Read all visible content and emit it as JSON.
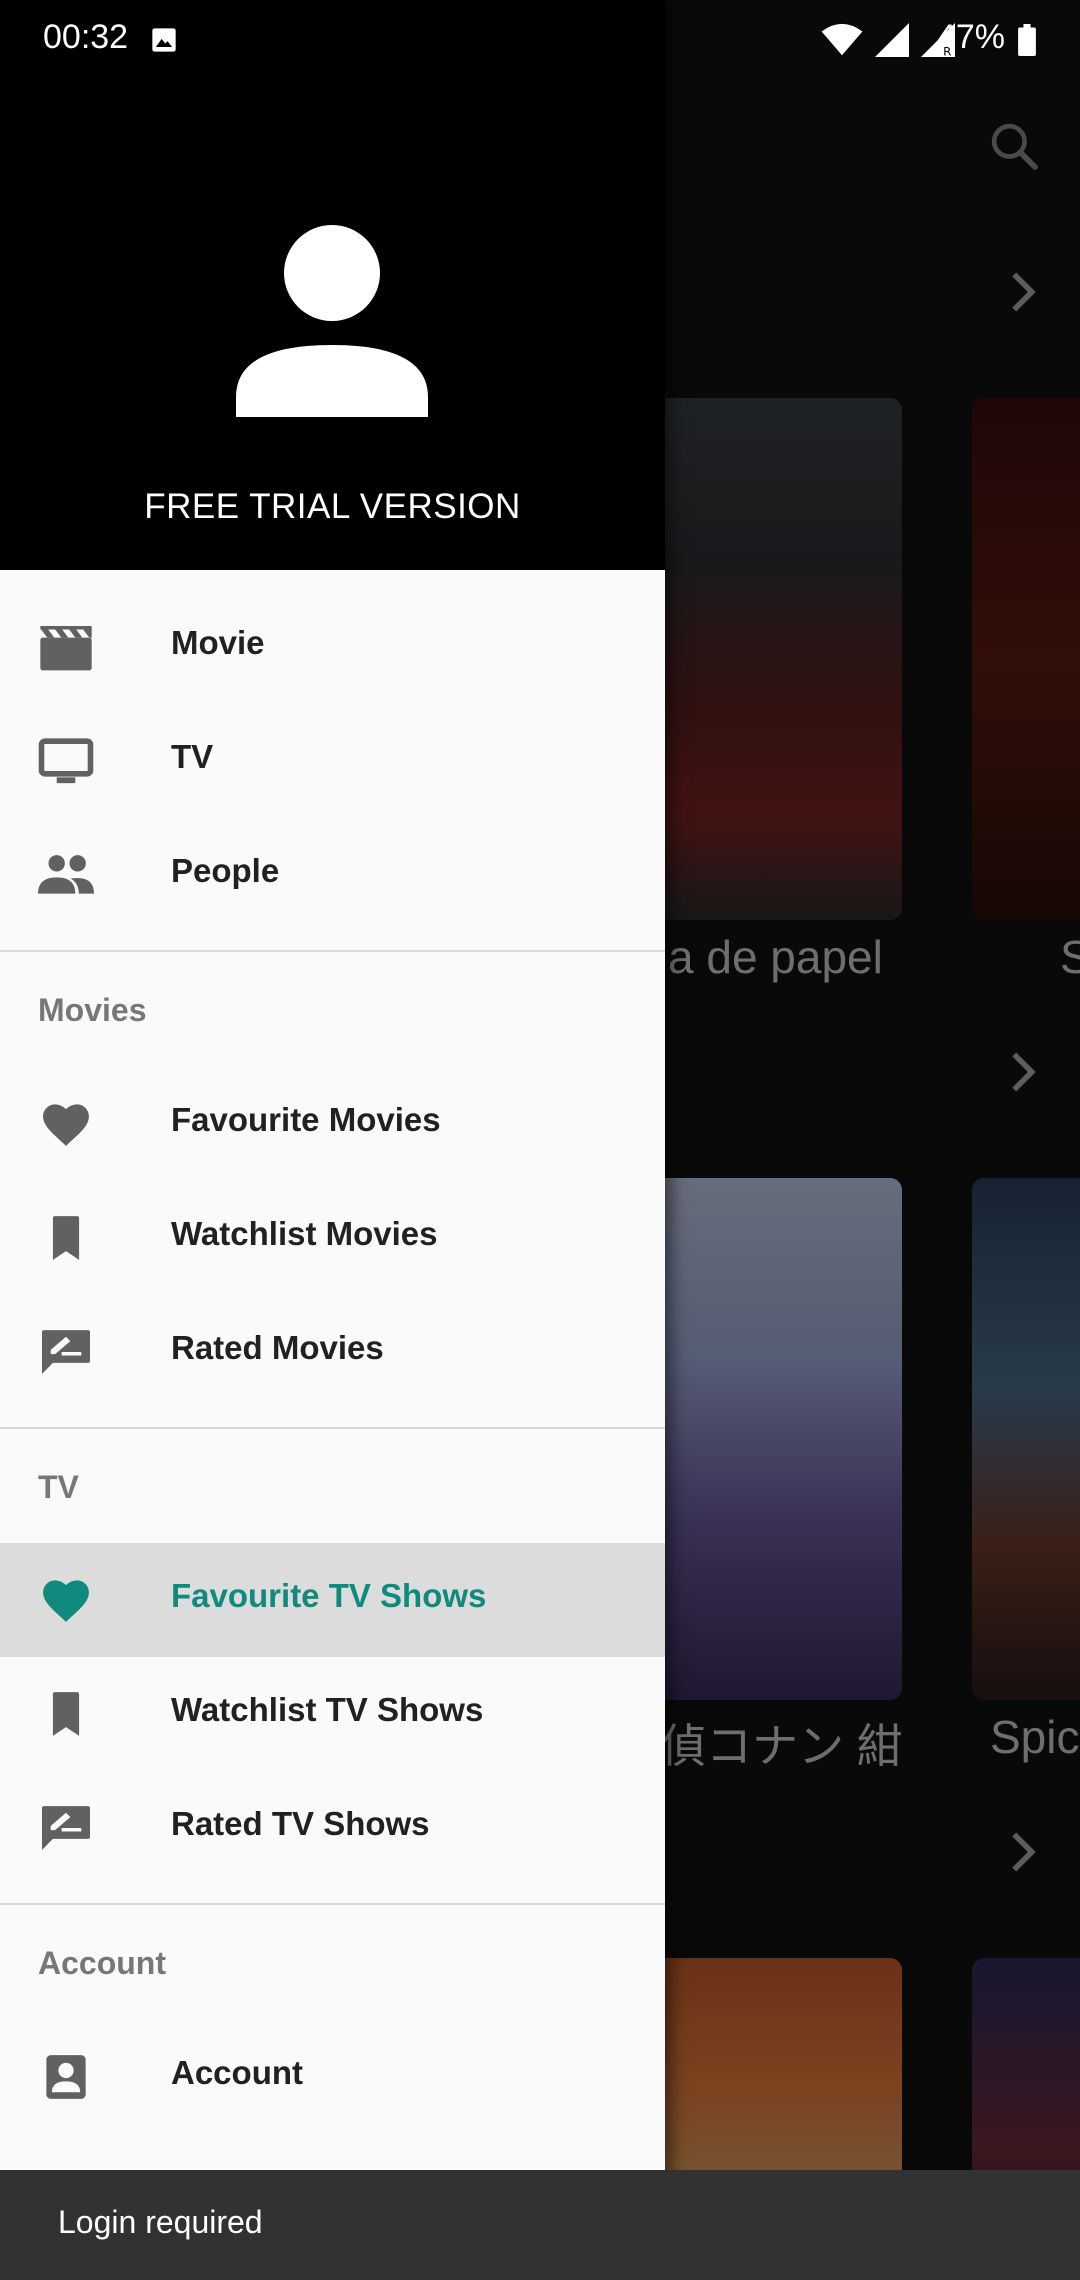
{
  "status_bar": {
    "time": "00:32",
    "battery_percent": "47%",
    "icons": [
      "image-icon",
      "wifi-icon",
      "signal-icon",
      "signal-roaming-icon",
      "battery-icon"
    ]
  },
  "background": {
    "icons": [
      "search-icon",
      "chevron-right-icon"
    ],
    "rows": [
      {
        "posters": [
          "LA CASA DE PAPEL / MONEY HEIST poster",
          "SHAZAM poster"
        ],
        "titles": [
          "a de papel",
          "S"
        ]
      },
      {
        "posters": [
          "Detective Conan anime poster",
          "Spider-Man poster"
        ],
        "titles": [
          "偵コナン 紺",
          "Spic"
        ]
      },
      {
        "posters": [
          "Once Upon a Time in Hollywood poster",
          "Spider-Man poster"
        ],
        "titles": []
      }
    ]
  },
  "drawer": {
    "header": {
      "avatar_icon": "person-icon",
      "title": "FREE TRIAL VERSION"
    },
    "main_items": [
      {
        "label": "Movie",
        "icon": "movie-clapper-icon"
      },
      {
        "label": "TV",
        "icon": "tv-icon"
      },
      {
        "label": "People",
        "icon": "people-icon"
      }
    ],
    "sections": {
      "movies": {
        "title": "Movies",
        "items": [
          {
            "label": "Favourite Movies",
            "icon": "heart-icon"
          },
          {
            "label": "Watchlist Movies",
            "icon": "bookmark-icon"
          },
          {
            "label": "Rated Movies",
            "icon": "rate-review-icon"
          }
        ]
      },
      "tv": {
        "title": "TV",
        "items": [
          {
            "label": "Favourite TV Shows",
            "icon": "heart-icon",
            "active": true
          },
          {
            "label": "Watchlist TV Shows",
            "icon": "bookmark-icon"
          },
          {
            "label": "Rated TV Shows",
            "icon": "rate-review-icon"
          }
        ]
      },
      "account": {
        "title": "Account",
        "items": [
          {
            "label": "Account",
            "icon": "account-box-icon"
          }
        ]
      }
    }
  },
  "snackbar": {
    "message": "Login required"
  },
  "colors": {
    "accent": "#0f8a7c",
    "drawer_background": "#fafafa",
    "header_background": "#000000",
    "active_item_background": "#dcdcdc",
    "snackbar_background": "#323232"
  }
}
